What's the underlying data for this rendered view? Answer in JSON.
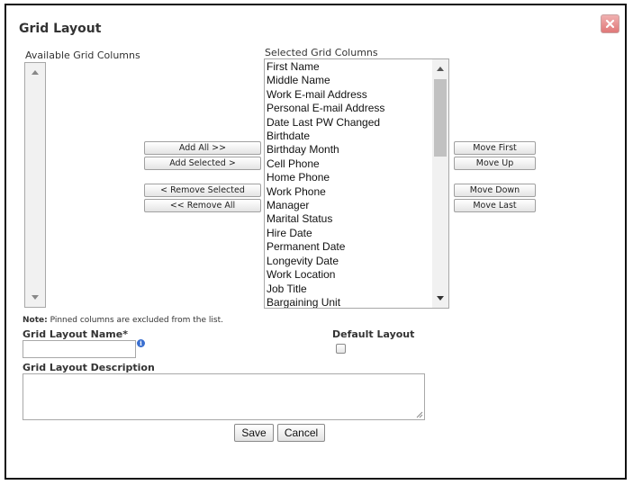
{
  "dialog": {
    "title": "Grid Layout",
    "close_icon": "close-x-icon"
  },
  "available": {
    "label": "Available Grid Columns",
    "items": []
  },
  "selected": {
    "label": "Selected Grid Columns",
    "items": [
      "First Name",
      "Middle Name",
      "Work E-mail Address",
      "Personal E-mail Address",
      "Date Last PW Changed",
      "Birthdate",
      "Birthday Month",
      "Cell Phone",
      "Home Phone",
      "Work Phone",
      "Manager",
      "Marital Status",
      "Hire Date",
      "Permanent Date",
      "Longevity Date",
      "Work Location",
      "Job Title",
      "Bargaining Unit"
    ]
  },
  "transfer_buttons": {
    "add_all": "Add All >>",
    "add_selected": "Add Selected >",
    "remove_selected": "< Remove Selected",
    "remove_all": "<< Remove All"
  },
  "order_buttons": {
    "move_first": "Move First",
    "move_up": "Move Up",
    "move_down": "Move Down",
    "move_last": "Move Last"
  },
  "note": {
    "prefix": "Note:",
    "text": " Pinned columns are excluded from the list."
  },
  "form": {
    "name_label": "Grid Layout Name*",
    "name_value": "",
    "default_label": "Default Layout",
    "default_checked": false,
    "description_label": "Grid Layout Description",
    "description_value": ""
  },
  "actions": {
    "save": "Save",
    "cancel": "Cancel"
  }
}
